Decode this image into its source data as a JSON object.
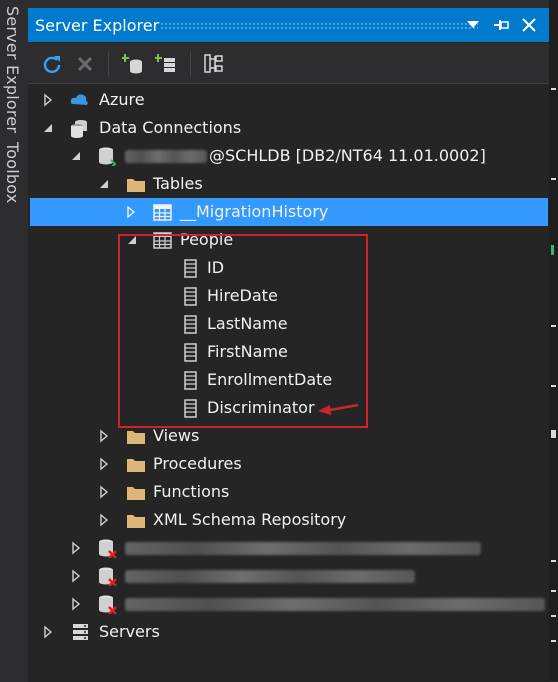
{
  "side_tabs": {
    "server_explorer": "Server Explorer",
    "toolbox": "Toolbox"
  },
  "panel": {
    "title": "Server Explorer"
  },
  "toolbar": {
    "buttons": [
      "refresh-icon",
      "stop-icon",
      "connect-to-database-icon",
      "connect-to-server-icon",
      "properties-icon"
    ]
  },
  "tree": {
    "azure": "Azure",
    "data_connections": "Data Connections",
    "connection": "@SCHLDB [DB2/NT64 11.01.0002]",
    "tables": "Tables",
    "migration_history": "__MigrationHistory",
    "people": "People",
    "columns": [
      "ID",
      "HireDate",
      "LastName",
      "FirstName",
      "EnrollmentDate",
      "Discriminator"
    ],
    "views": "Views",
    "procedures": "Procedures",
    "functions": "Functions",
    "xml_schema": "XML Schema Repository",
    "servers": "Servers"
  },
  "colors": {
    "accent": "#007acc",
    "selection": "#3399ff",
    "annotation": "#d0242c",
    "folder": "#dcb67a"
  }
}
